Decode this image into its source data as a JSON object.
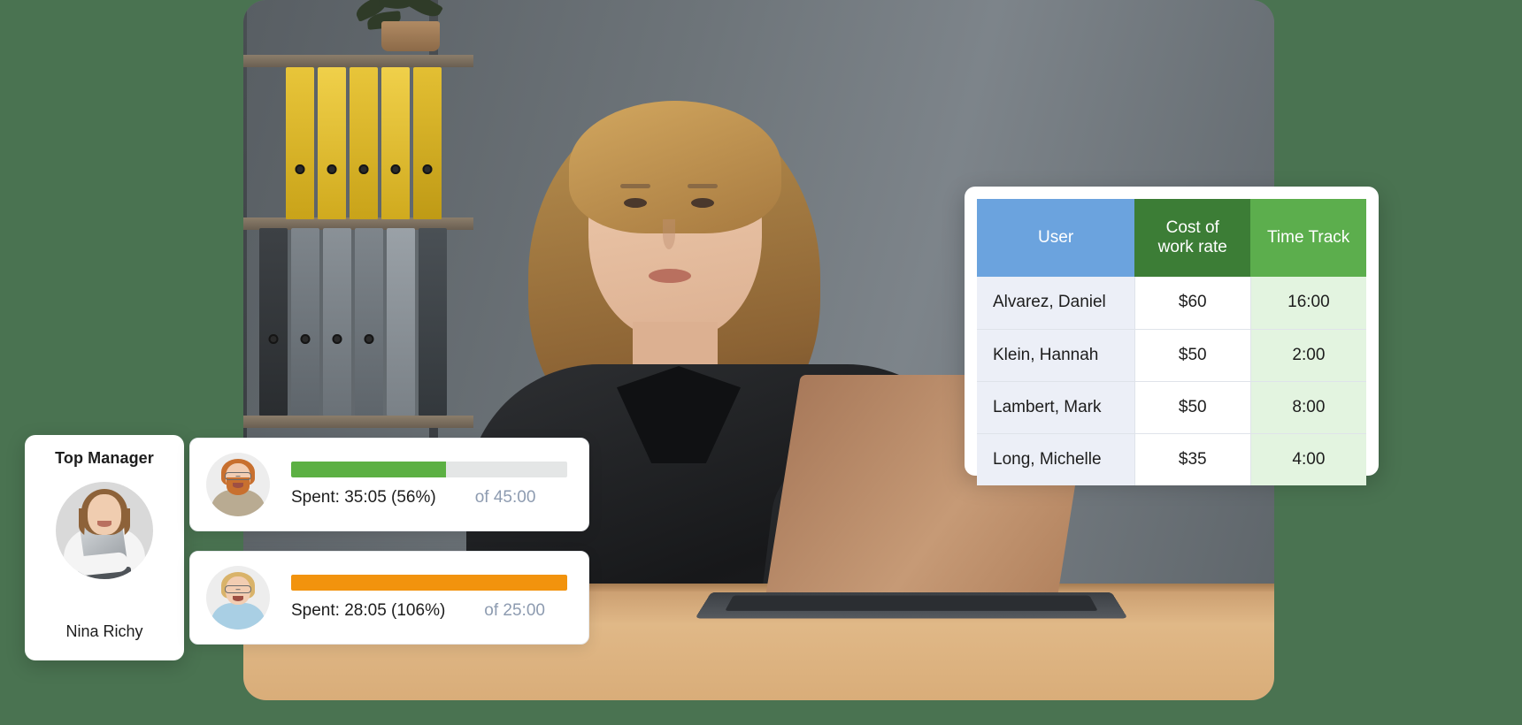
{
  "theme": {
    "background": "#4a7351",
    "header_user": "#6ba3de",
    "header_cost": "#3c7d36",
    "header_time": "#5cae4d",
    "row_user_bg": "#eceff7",
    "row_time_bg": "#e3f4e0",
    "bar_green": "#5cb043",
    "bar_orange": "#f2930d",
    "bar_track": "#e4e6e6",
    "muted_text": "#8d9bb0"
  },
  "manager_card": {
    "title": "Top Manager",
    "avatar": "manager-portrait-avatar",
    "name": "Nina Richy"
  },
  "progress_cards": [
    {
      "avatar": "user-avatar-bearded-man",
      "bar_color": "#5cb043",
      "fill_percent": 56,
      "spent_label": "Spent: 35:05 (56%)",
      "of_label": "of 45:00",
      "spent_time": "35:05",
      "percent": "56%",
      "budget_time": "45:00"
    },
    {
      "avatar": "user-avatar-blonde-woman",
      "bar_color": "#f2930d",
      "fill_percent": 100,
      "spent_label": "Spent: 28:05 (106%)",
      "of_label": "of 25:00",
      "spent_time": "28:05",
      "percent": "106%",
      "budget_time": "25:00"
    }
  ],
  "rate_table": {
    "columns": [
      "User",
      "Cost of\nwork rate",
      "Time Track"
    ],
    "columns_display": {
      "user": "User",
      "cost_line1": "Cost of",
      "cost_line2": "work rate",
      "time": "Time Track"
    },
    "rows": [
      {
        "user": "Alvarez, Daniel",
        "cost": "$60",
        "time": "16:00"
      },
      {
        "user": "Klein, Hannah",
        "cost": "$50",
        "time": "2:00"
      },
      {
        "user": "Lambert, Mark",
        "cost": "$50",
        "time": "8:00"
      },
      {
        "user": "Long, Michelle",
        "cost": "$35",
        "time": "4:00"
      }
    ]
  },
  "hero_photo": {
    "alt": "woman-at-desk-with-laptop-photo"
  }
}
